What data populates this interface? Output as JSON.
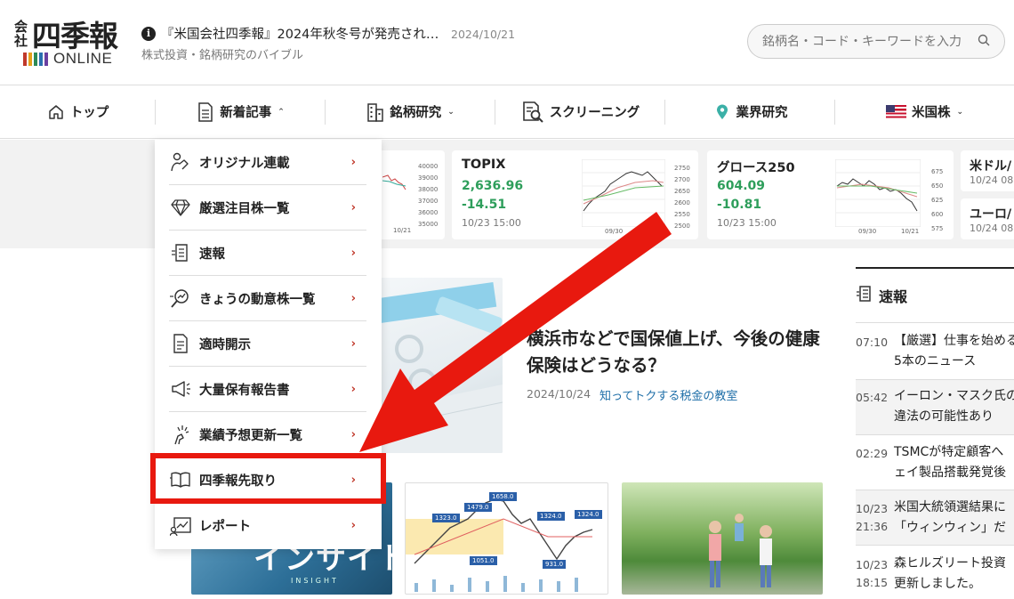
{
  "header": {
    "logo_kaisha": "会社",
    "logo_kanji": "四季報",
    "logo_online": "ONLINE",
    "notice_icon": "i",
    "notice_text": "『米国会社四季報』2024年秋冬号が発売され…",
    "notice_date": "2024/10/21",
    "tagline": "株式投資・銘柄研究のバイブル",
    "search_placeholder": "銘柄名・コード・キーワードを入力",
    "logo_bar_colors": [
      "#c0392b",
      "#e6a11a",
      "#2e8b57",
      "#2a6fb0",
      "#6a3fa0"
    ]
  },
  "nav": {
    "items": [
      {
        "label": "トップ",
        "icon": "home-icon"
      },
      {
        "label": "新着記事",
        "icon": "document-icon",
        "caret": "⌃"
      },
      {
        "label": "銘柄研究",
        "icon": "building-icon",
        "caret": "⌄"
      },
      {
        "label": "スクリーニング",
        "icon": "screening-icon"
      },
      {
        "label": "業界研究",
        "icon": "location-pin-icon"
      },
      {
        "label": "米国株",
        "icon": "us-flag-icon",
        "caret": "⌄"
      }
    ]
  },
  "ticker": {
    "card1_ticks": [
      "40000",
      "39000",
      "38000",
      "37000",
      "36000",
      "35000"
    ],
    "card1_xtick": "10/21",
    "topix": {
      "name": "TOPIX",
      "price": "2,636.96",
      "change": "-14.51",
      "time": "10/23 15:00",
      "ticks": [
        "2750",
        "2700",
        "2650",
        "2600",
        "2550",
        "2500"
      ],
      "xtick": "09/30"
    },
    "growth": {
      "name": "グロース250",
      "price": "604.09",
      "change": "-10.81",
      "time": "10/23 15:00",
      "ticks": [
        "675",
        "650",
        "625",
        "600",
        "575"
      ],
      "xticks": [
        "09/30",
        "10/21"
      ]
    },
    "usd": {
      "name": "米ドル/",
      "time": "10/24 08:0"
    },
    "eur": {
      "name": "ユーロ/",
      "time": "10/24 08:0"
    },
    "up_color": "#2e9e5b"
  },
  "dropdown": {
    "items": [
      {
        "label": "オリジナル連載",
        "icon": "original-series-icon"
      },
      {
        "label": "厳選注目株一覧",
        "icon": "diamond-icon"
      },
      {
        "label": "速報",
        "icon": "news-flash-icon"
      },
      {
        "label": "きょうの動意株一覧",
        "icon": "magnifier-chart-icon"
      },
      {
        "label": "適時開示",
        "icon": "disclosure-document-icon"
      },
      {
        "label": "大量保有報告書",
        "icon": "megaphone-icon"
      },
      {
        "label": "業績予想更新一覧",
        "icon": "sparkle-hand-icon"
      },
      {
        "label": "四季報先取り",
        "icon": "open-book-icon"
      },
      {
        "label": "レポート",
        "icon": "report-chart-icon"
      }
    ],
    "arrow": "›"
  },
  "hero": {
    "title": "横浜市などで国保値上げ、今後の健康保険はどうなる？",
    "date": "2024/10/24",
    "category": "知ってトクする税金の教室"
  },
  "thumbs": {
    "insight_text": "インサイト",
    "insight_sub": "INSIGHT",
    "chart_labels": [
      "1323.0",
      "1479.0",
      "1658.0",
      "1324.0",
      "1051.0",
      "931.0",
      "1324.0"
    ]
  },
  "sokuho": {
    "title": "速報",
    "items": [
      {
        "time": "07:10",
        "line1": "【厳選】仕事を始める",
        "line2": "5本のニュース"
      },
      {
        "time": "05:42",
        "line1": "イーロン・マスク氏の",
        "line2": "違法の可能性あり"
      },
      {
        "time": "02:29",
        "line1": "TSMCが特定顧客へ",
        "line2": "ェイ製品搭載発覚後"
      },
      {
        "time": "10/23",
        "time2": "21:36",
        "line1": "米国大統領選結果に",
        "line2": "「ウィンウィン」だ"
      },
      {
        "time": "10/23",
        "time2": "18:15",
        "line1": "森ヒルズリート投資",
        "line2": "更新しました。"
      }
    ]
  },
  "annotation": {
    "color": "#e8190f"
  }
}
